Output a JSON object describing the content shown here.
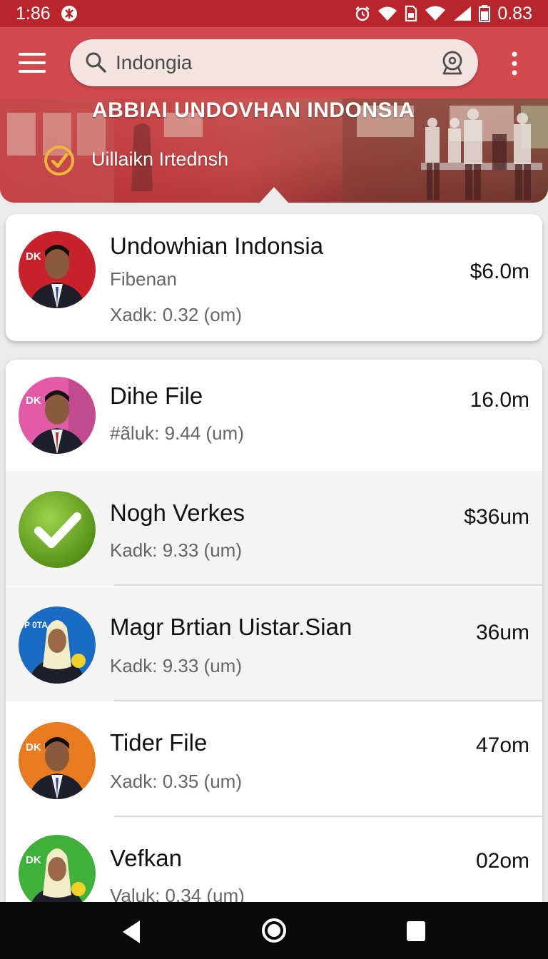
{
  "status_bar": {
    "time": "1:86",
    "battery_text": "0.83",
    "icons": [
      "app-notification-icon",
      "alarm-icon",
      "wifi-icon",
      "sim-icon",
      "signal-icon",
      "battery-icon"
    ]
  },
  "app_bar": {
    "search_value": "Indongia",
    "icons": [
      "menu-icon",
      "search-icon",
      "lens-icon",
      "overflow-menu-icon"
    ]
  },
  "banner": {
    "title": "ABBIAI UNDOVHAN INDONSIA",
    "subtitle": "Uillaikn Irtednsh",
    "icon": "check-circle-icon"
  },
  "featured": {
    "name": "Undowhian Indonsia",
    "line1": "Fibenan",
    "line2": "Xadk: 0.32 (om)",
    "amount": "$6.0m",
    "badge": "DK"
  },
  "items": [
    {
      "name": "Dihe File",
      "sub": "#ãluk: 9.44 (um)",
      "amount": "16.0m",
      "badge": "DK"
    },
    {
      "name": "Nogh Verkes",
      "sub": "Kadk: 9.33 (um)",
      "amount": "$36um",
      "icon": "check-icon"
    },
    {
      "name": "Magr Brtian Uistar.Sian",
      "sub": "Kadk: 9.33 (um)",
      "amount": "36um",
      "badge": "P 0TA"
    },
    {
      "name": "Tider File",
      "sub": "Xadk: 0.35 (um)",
      "amount": "47om",
      "badge": "DK"
    },
    {
      "name": "Vefkan",
      "sub": "Valuk: 0.34 (um)",
      "amount": "02om",
      "badge": "DK"
    }
  ],
  "colors": {
    "status_bar": "#b8262c",
    "app_bar": "#d24a4e",
    "avatar_red": "#c8232b",
    "avatar_pink": "#e35aa6",
    "check_green": "#6aa61e",
    "avatar_blue": "#1a6bc4",
    "avatar_orange": "#e87a1f",
    "avatar_green": "#3fb03a"
  }
}
